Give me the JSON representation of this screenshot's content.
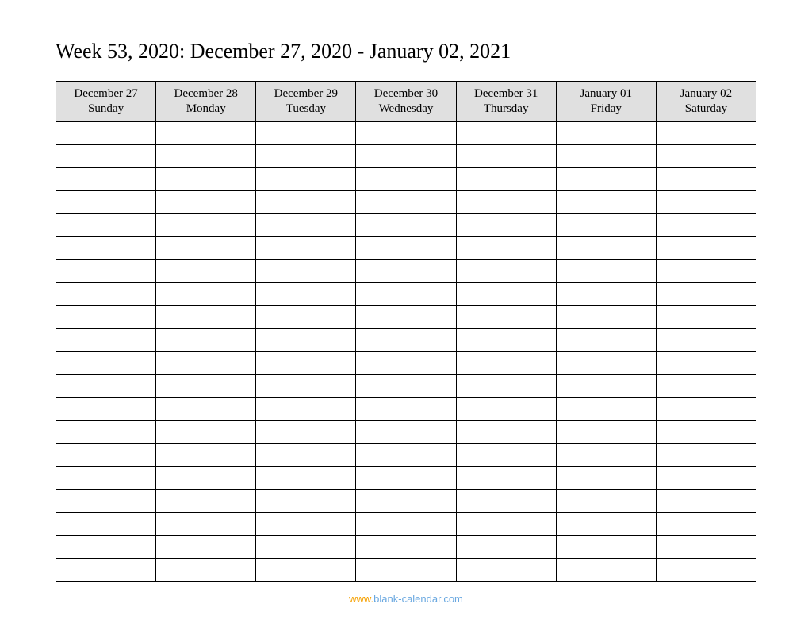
{
  "title": "Week 53, 2020: December 27, 2020 - January 02, 2021",
  "columns": [
    {
      "date": "December 27",
      "day": "Sunday"
    },
    {
      "date": "December 28",
      "day": "Monday"
    },
    {
      "date": "December 29",
      "day": "Tuesday"
    },
    {
      "date": "December 30",
      "day": "Wednesday"
    },
    {
      "date": "December 31",
      "day": "Thursday"
    },
    {
      "date": "January 01",
      "day": "Friday"
    },
    {
      "date": "January 02",
      "day": "Saturday"
    }
  ],
  "row_count": 20,
  "footer": {
    "www": "www.",
    "domain": "blank-calendar.com"
  }
}
